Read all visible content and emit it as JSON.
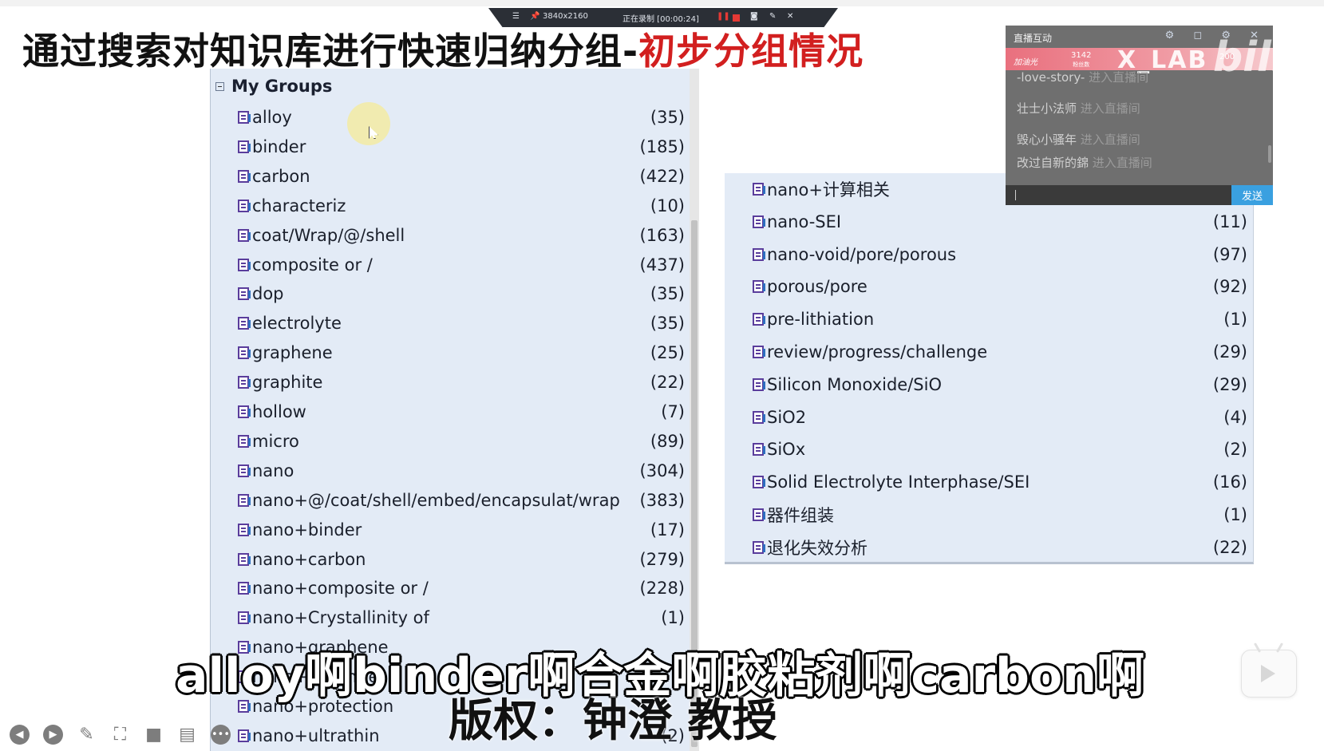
{
  "recorder": {
    "resolution": "3840x2160",
    "status": "正在录制 [00:00:24]"
  },
  "title": {
    "main": "通过搜索对知识库进行快速归纳分组-",
    "highlight": "初步分组情况"
  },
  "groups_header": "My Groups",
  "left_groups": [
    {
      "name": "alloy",
      "count": "(35)"
    },
    {
      "name": "binder",
      "count": "(185)"
    },
    {
      "name": "carbon",
      "count": "(422)"
    },
    {
      "name": "characteriz",
      "count": "(10)"
    },
    {
      "name": "coat/Wrap/@/shell",
      "count": "(163)"
    },
    {
      "name": "composite or /",
      "count": "(437)"
    },
    {
      "name": "dop",
      "count": "(35)"
    },
    {
      "name": "electrolyte",
      "count": "(35)"
    },
    {
      "name": "graphene",
      "count": "(25)"
    },
    {
      "name": "graphite",
      "count": "(22)"
    },
    {
      "name": "hollow",
      "count": "(7)"
    },
    {
      "name": "micro",
      "count": "(89)"
    },
    {
      "name": "nano",
      "count": "(304)"
    },
    {
      "name": "nano+@/coat/shell/embed/encapsulat/wrap",
      "count": "(383)"
    },
    {
      "name": "nano+binder",
      "count": "(17)"
    },
    {
      "name": "nano+carbon",
      "count": "(279)"
    },
    {
      "name": "nano+composite or /",
      "count": "(228)"
    },
    {
      "name": "nano+Crystallinity of",
      "count": "(1)"
    },
    {
      "name": "nano+graphene",
      "count": ""
    },
    {
      "name": "nano+graphite",
      "count": ""
    },
    {
      "name": "nano+protection",
      "count": ""
    },
    {
      "name": "nano+ultrathin",
      "count": "(2)"
    }
  ],
  "right_groups": [
    {
      "name": "nano+计算相关",
      "count": "(1)"
    },
    {
      "name": "nano-SEI",
      "count": "(11)"
    },
    {
      "name": "nano-void/pore/porous",
      "count": "(97)"
    },
    {
      "name": "porous/pore",
      "count": "(92)"
    },
    {
      "name": "pre-lithiation",
      "count": "(1)"
    },
    {
      "name": "review/progress/challenge",
      "count": "(29)"
    },
    {
      "name": "Silicon Monoxide/SiO",
      "count": "(29)"
    },
    {
      "name": "SiO2",
      "count": "(4)"
    },
    {
      "name": "SiOx",
      "count": "(2)"
    },
    {
      "name": "Solid Electrolyte Interphase/SEI",
      "count": "(16)"
    },
    {
      "name": "器件组装",
      "count": "(1)"
    },
    {
      "name": "退化失效分析",
      "count": "(22)"
    }
  ],
  "chat": {
    "title": "直播互动",
    "banner_left": "加油光",
    "banner_count": "3142",
    "banner_count_label": "粉丝数",
    "banner_brand": "X_LAB",
    "banner_num": "200",
    "logo": "bilibili",
    "messages": [
      {
        "user": "-love-story-",
        "action": "进入直播间"
      },
      {
        "user": "壮士小法师",
        "action": "进入直播间"
      },
      {
        "user": "毁心小骚年",
        "action": "进入直播间"
      },
      {
        "user": "改过自新的錦",
        "action": "进入直播间"
      }
    ],
    "send_label": "发送"
  },
  "subtitles": {
    "line1": "alloy啊binder啊合金啊胶粘剂啊carbon啊",
    "line2": "版权：钟澄 教授"
  },
  "icons": {
    "group_icon": "group-document-icon",
    "collapse": "collapse-minus-icon",
    "controls": [
      "back-icon",
      "play-icon",
      "pen-icon",
      "screenshot-icon",
      "camera-icon",
      "comment-icon",
      "more-icon"
    ],
    "tv": "bilibili-tv-play-icon"
  }
}
